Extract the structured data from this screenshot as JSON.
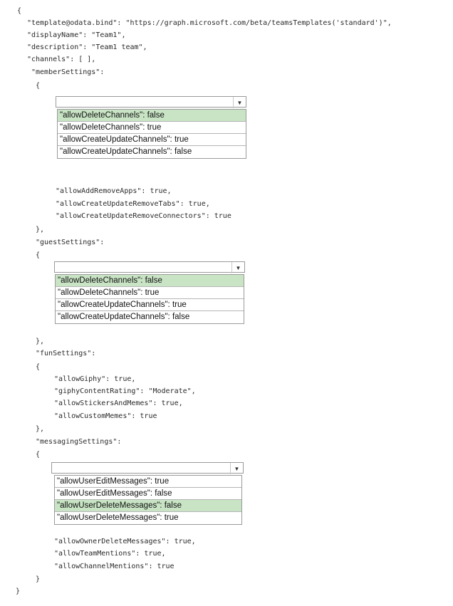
{
  "code": {
    "l_open": "{",
    "l_template": "\"template@odata.bind\": \"https://graph.microsoft.com/beta/teamsTemplates('standard')\",",
    "l_display": "\"displayName\": \"Team1\",",
    "l_desc": "\"description\": \"Team1 team\",",
    "l_channels": "\"channels\": [ ],",
    "l_member": "\"memberSettings\":",
    "l_member_open": "{",
    "l_addremove": "\"allowAddRemoveApps\": true,",
    "l_tabs": "\"allowCreateUpdateRemoveTabs\": true,",
    "l_connectors": "\"allowCreateUpdateRemoveConnectors\": true",
    "l_member_close": "},",
    "l_guest": "\"guestSettings\":",
    "l_guest_open": "{",
    "l_guest_close": "},",
    "l_fun": "\"funSettings\":",
    "l_fun_open": "{",
    "l_giphy": "\"allowGiphy\": true,",
    "l_rating": "\"giphyContentRating\": \"Moderate\",",
    "l_stickers": "\"allowStickersAndMemes\": true,",
    "l_custom": "\"allowCustomMemes\": true",
    "l_fun_close": "},",
    "l_msg": "\"messagingSettings\":",
    "l_msg_open": "{",
    "l_owner": "\"allowOwnerDeleteMessages\": true,",
    "l_team": "\"allowTeamMentions\": true,",
    "l_channel": "\"allowChannelMentions\": true",
    "l_msg_close": "}",
    "l_end": "}"
  },
  "dropdowns": {
    "member": {
      "arrow_icon": "chevron-down-icon",
      "options": [
        "\"allowDeleteChannels\": false",
        "\"allowDeleteChannels\": true",
        "\"allowCreateUpdateChannels\": true",
        "\"allowCreateUpdateChannels\": false"
      ],
      "selected_index": 0
    },
    "guest": {
      "arrow_icon": "chevron-down-icon",
      "options": [
        "\"allowDeleteChannels\": false",
        "\"allowDeleteChannels\": true",
        "\"allowCreateUpdateChannels\": true",
        "\"allowCreateUpdateChannels\": false"
      ],
      "selected_index": 0
    },
    "messaging": {
      "arrow_icon": "chevron-down-icon",
      "options": [
        "\"allowUserEditMessages\": true",
        "\"allowUserEditMessages\": false",
        "\"allowUserDeleteMessages\": false",
        "\"allowUserDeleteMessages\": true"
      ],
      "selected_index": 2
    }
  },
  "colors": {
    "selected_option": "#c8e4c4",
    "border": "#9a9a9a",
    "text": "#2a2a2a"
  }
}
